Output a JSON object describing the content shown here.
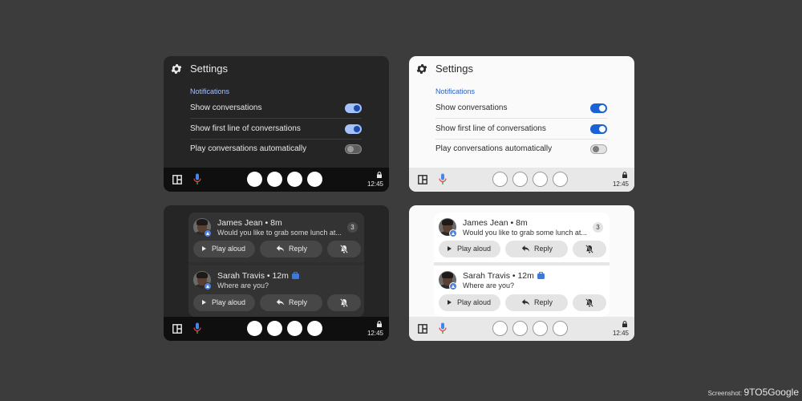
{
  "settings": {
    "title": "Settings",
    "section": "Notifications",
    "rows": [
      {
        "label": "Show conversations",
        "on": true
      },
      {
        "label": "Show first line of conversations",
        "on": true
      },
      {
        "label": "Play conversations automatically",
        "on": false
      }
    ]
  },
  "dock": {
    "time": "12:45"
  },
  "notifications": [
    {
      "name": "James Jean • 8m",
      "message": "Would you like to grab some lunch at...",
      "count": "3"
    },
    {
      "name": "Sarah Travis • 12m",
      "message": "Where are you?"
    }
  ],
  "actions": {
    "play": "Play aloud",
    "reply": "Reply"
  },
  "credit": {
    "prefix": "Screenshot:",
    "brand": "9TO5Google"
  },
  "icons": [
    "gear-icon",
    "grid-icon",
    "mic-icon",
    "lock-icon",
    "play-icon",
    "reply-icon",
    "mute-icon",
    "briefcase-icon"
  ]
}
